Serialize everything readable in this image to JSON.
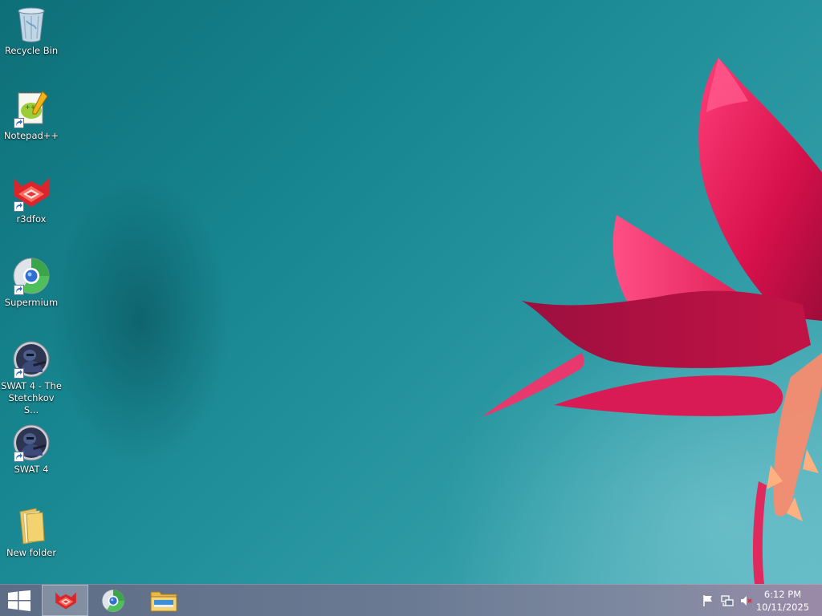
{
  "desktop": {
    "icons": [
      {
        "label": "Recycle Bin",
        "icon": "recycle-bin-icon",
        "shortcut": false
      },
      {
        "label": "Notepad++",
        "icon": "notepad-plus-plus-icon",
        "shortcut": true
      },
      {
        "label": "r3dfox",
        "icon": "r3dfox-icon",
        "shortcut": true
      },
      {
        "label": "Supermium",
        "icon": "supermium-icon",
        "shortcut": true
      },
      {
        "label": "SWAT 4 - The Stetchkov S...",
        "icon": "swat4-icon",
        "shortcut": true
      },
      {
        "label": "SWAT 4",
        "icon": "swat4-icon",
        "shortcut": true
      },
      {
        "label": "New folder",
        "icon": "folder-icon",
        "shortcut": false
      }
    ]
  },
  "taskbar": {
    "start": {
      "icon": "windows-logo-icon"
    },
    "pinned": [
      {
        "name": "r3dfox",
        "icon": "r3dfox-icon",
        "active": true
      },
      {
        "name": "Supermium",
        "icon": "supermium-icon",
        "active": false
      },
      {
        "name": "File Explorer",
        "icon": "file-explorer-icon",
        "active": false
      }
    ],
    "tray": {
      "icons": [
        "action-center-flag-icon",
        "network-icon",
        "volume-muted-icon"
      ],
      "time": "6:12 PM",
      "date": "10/11/2025"
    }
  },
  "colors": {
    "wallpaper_base": "#178690",
    "flower": "#d8164f",
    "taskbar": "#6b7a93"
  }
}
